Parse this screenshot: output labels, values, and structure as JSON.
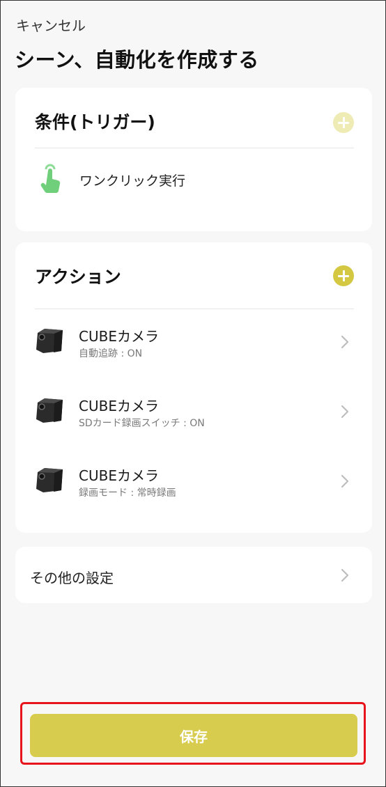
{
  "header": {
    "cancel_label": "キャンセル",
    "title": "シーン、自動化を作成する"
  },
  "conditions": {
    "title": "条件(トリガー)",
    "add_icon": "plus-circle-icon",
    "items": [
      {
        "label": "ワンクリック実行",
        "icon": "tap-hand-icon"
      }
    ]
  },
  "actions": {
    "title": "アクション",
    "add_icon": "plus-circle-icon",
    "items": [
      {
        "title": "CUBEカメラ",
        "subtitle": "自動追跡 : ON",
        "icon": "camera-cube-icon"
      },
      {
        "title": "CUBEカメラ",
        "subtitle": "SDカード録画スイッチ : ON",
        "icon": "camera-cube-icon"
      },
      {
        "title": "CUBEカメラ",
        "subtitle": "録画モード : 常時録画",
        "icon": "camera-cube-icon"
      }
    ]
  },
  "other": {
    "label": "その他の設定"
  },
  "footer": {
    "save_label": "保存"
  },
  "colors": {
    "accent": "#d4c843",
    "accent_disabled": "#efebb5",
    "save_button": "#d8cc4e",
    "trigger_icon": "#6fcf7a",
    "highlight": "#e8141c",
    "background": "#f7f7f7"
  }
}
